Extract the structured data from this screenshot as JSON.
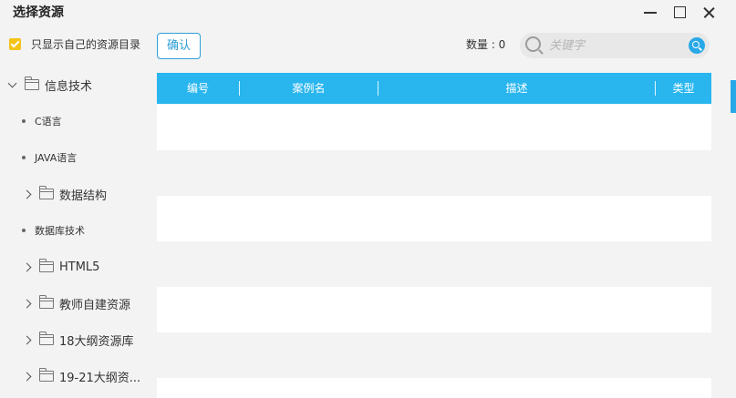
{
  "window": {
    "title": "选择资源",
    "controls": [
      "minimize-icon",
      "maximize-icon",
      "close-icon"
    ]
  },
  "toolbar": {
    "own_only_label": "只显示自己的资源目录",
    "own_only_checked": true,
    "confirm_label": "确认",
    "count_text": "数量 : 0"
  },
  "search": {
    "placeholder": "关键字",
    "value": ""
  },
  "tree": {
    "items": [
      {
        "label": "信息技术",
        "kind": "folder",
        "expanded": true
      },
      {
        "label": "C语言",
        "kind": "leaf"
      },
      {
        "label": "JAVA语言",
        "kind": "leaf"
      },
      {
        "label": "数据结构",
        "kind": "folder",
        "expanded": false
      },
      {
        "label": "数据库技术",
        "kind": "leaf"
      },
      {
        "label": "HTML5",
        "kind": "folder",
        "expanded": false
      },
      {
        "label": "教师自建资源",
        "kind": "folder",
        "expanded": false
      },
      {
        "label": "18大纲资源库",
        "kind": "folder",
        "expanded": false
      },
      {
        "label": "19-21大纲资...",
        "kind": "folder",
        "expanded": false
      }
    ]
  },
  "table": {
    "columns": [
      "编号",
      "案例名",
      "描述",
      "类型"
    ],
    "rows": []
  },
  "colors": {
    "accent": "#29b6ef",
    "checkbox": "#f4c316",
    "background": "#f3f3f3"
  }
}
